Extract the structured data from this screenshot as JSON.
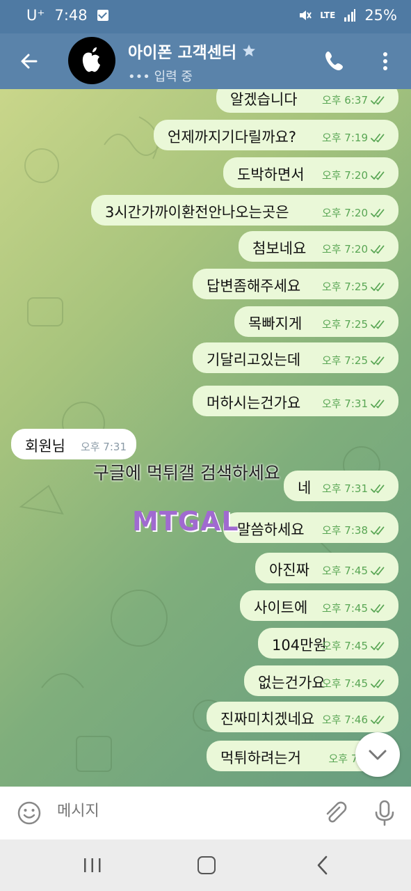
{
  "status_bar": {
    "carrier": "U⁺",
    "time": "7:48",
    "network": "LTE",
    "battery": "25%"
  },
  "header": {
    "title": "아이폰 고객센터",
    "status": "입력 중"
  },
  "messages": [
    {
      "text": "알겠습니다",
      "time": "오후 6:37",
      "dir": "out"
    },
    {
      "text": "언제까지기다릴까요?",
      "time": "오후 7:19",
      "dir": "out"
    },
    {
      "text": "도박하면서",
      "time": "오후 7:20",
      "dir": "out"
    },
    {
      "text": "3시간가까이환전안나오는곳은",
      "time": "오후 7:20",
      "dir": "out"
    },
    {
      "text": "첨보네요",
      "time": "오후 7:20",
      "dir": "out"
    },
    {
      "text": "답변좀해주세요",
      "time": "오후 7:25",
      "dir": "out"
    },
    {
      "text": "목빠지게",
      "time": "오후 7:25",
      "dir": "out"
    },
    {
      "text": "기달리고있는데",
      "time": "오후 7:25",
      "dir": "out"
    },
    {
      "text": "머하시는건가요",
      "time": "오후 7:31",
      "dir": "out"
    },
    {
      "text": "회원님",
      "time": "오후 7:31",
      "dir": "in"
    },
    {
      "text": "네",
      "time": "오후 7:31",
      "dir": "out"
    },
    {
      "text": "말씀하세요",
      "time": "오후 7:38",
      "dir": "out"
    },
    {
      "text": "아진짜",
      "time": "오후 7:45",
      "dir": "out"
    },
    {
      "text": "사이트에",
      "time": "오후 7:45",
      "dir": "out"
    },
    {
      "text": "104만원",
      "time": "오후 7:45",
      "dir": "out"
    },
    {
      "text": "없는건가요",
      "time": "오후 7:45",
      "dir": "out"
    },
    {
      "text": "진짜미치겠네요",
      "time": "오후 7:46",
      "dir": "out"
    },
    {
      "text": "먹튀하려는거",
      "time": "오후 7:4",
      "dir": "out"
    }
  ],
  "watermark": {
    "logo": "MTGAL",
    "text": "구글에 먹튀갤 검색하세요"
  },
  "composer": {
    "placeholder": "메시지"
  },
  "colors": {
    "header": "#5a83aa",
    "outgoing_bubble": "#eaf8d8",
    "tick": "#59a654"
  }
}
